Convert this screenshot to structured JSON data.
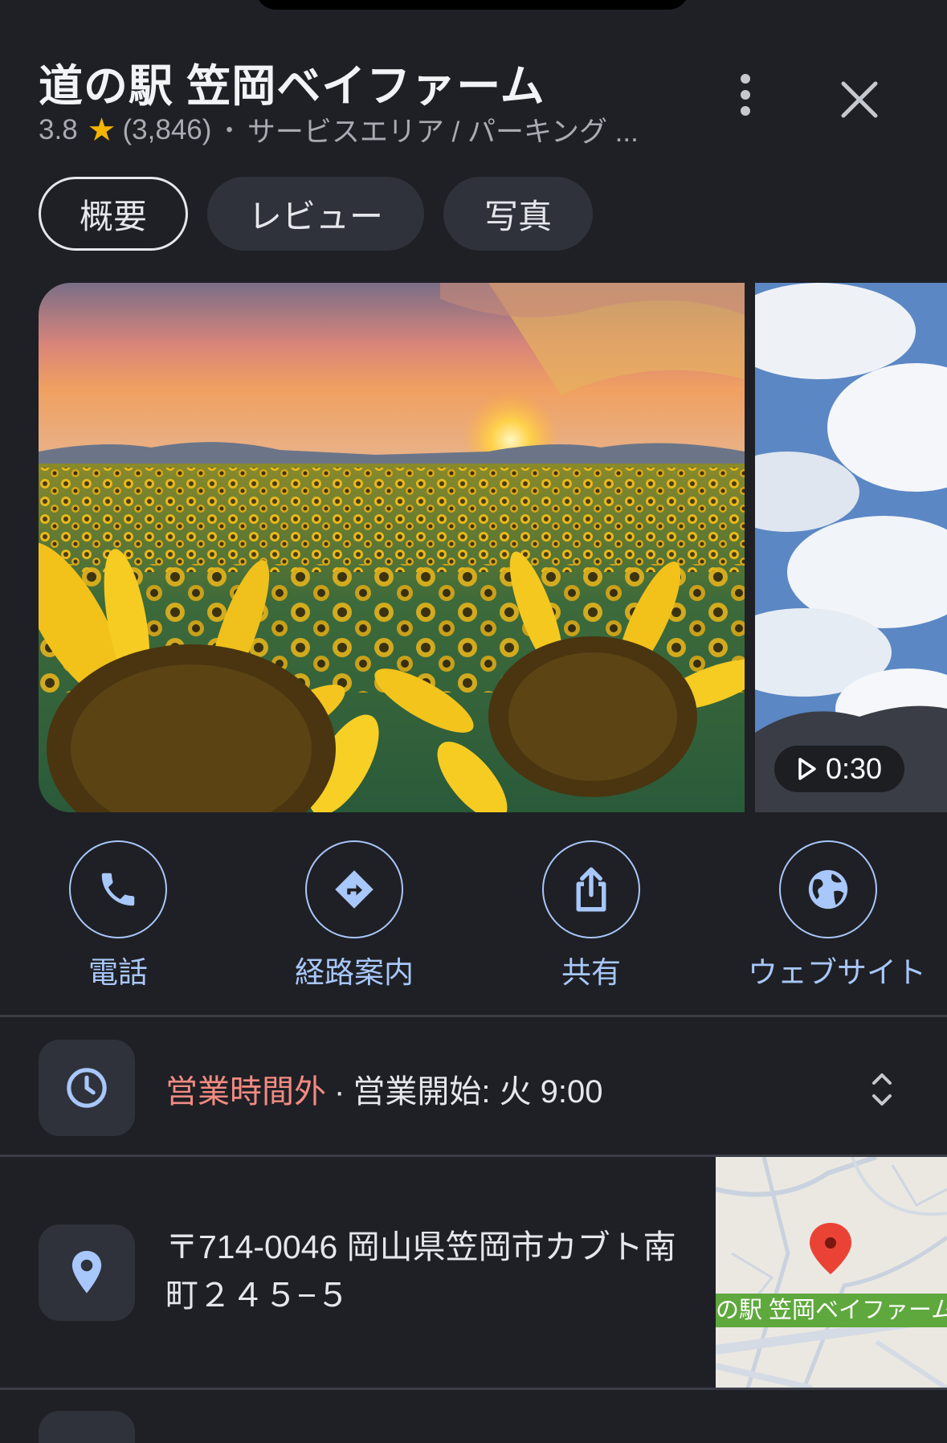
{
  "place": {
    "name": "道の駅 笠岡ベイファーム",
    "rating": "3.8",
    "review_count": "(3,846)",
    "category": "サービスエリア / パーキング ..."
  },
  "tabs": [
    {
      "label": "概要",
      "active": true
    },
    {
      "label": "レビュー",
      "active": false
    },
    {
      "label": "写真",
      "active": false
    }
  ],
  "media": {
    "video_duration": "0:30"
  },
  "actions": [
    {
      "label": "電話",
      "icon": "phone-icon"
    },
    {
      "label": "経路案内",
      "icon": "directions-icon"
    },
    {
      "label": "共有",
      "icon": "share-icon"
    },
    {
      "label": "ウェブサイト",
      "icon": "globe-icon"
    }
  ],
  "hours": {
    "status": "営業時間外",
    "separator": "·",
    "next_open": "営業開始: 火 9:00"
  },
  "address": {
    "text": "〒714-0046 岡山県笠岡市カブト南町２４５−５",
    "map_label": "の駅 笠岡ベイファーム"
  },
  "colors": {
    "background": "#1f2025",
    "accent": "#a8c7fa",
    "closed": "#f28b82",
    "star": "#f4b400",
    "map_label": "#5fa83d",
    "map_pin": "#ea4335"
  }
}
